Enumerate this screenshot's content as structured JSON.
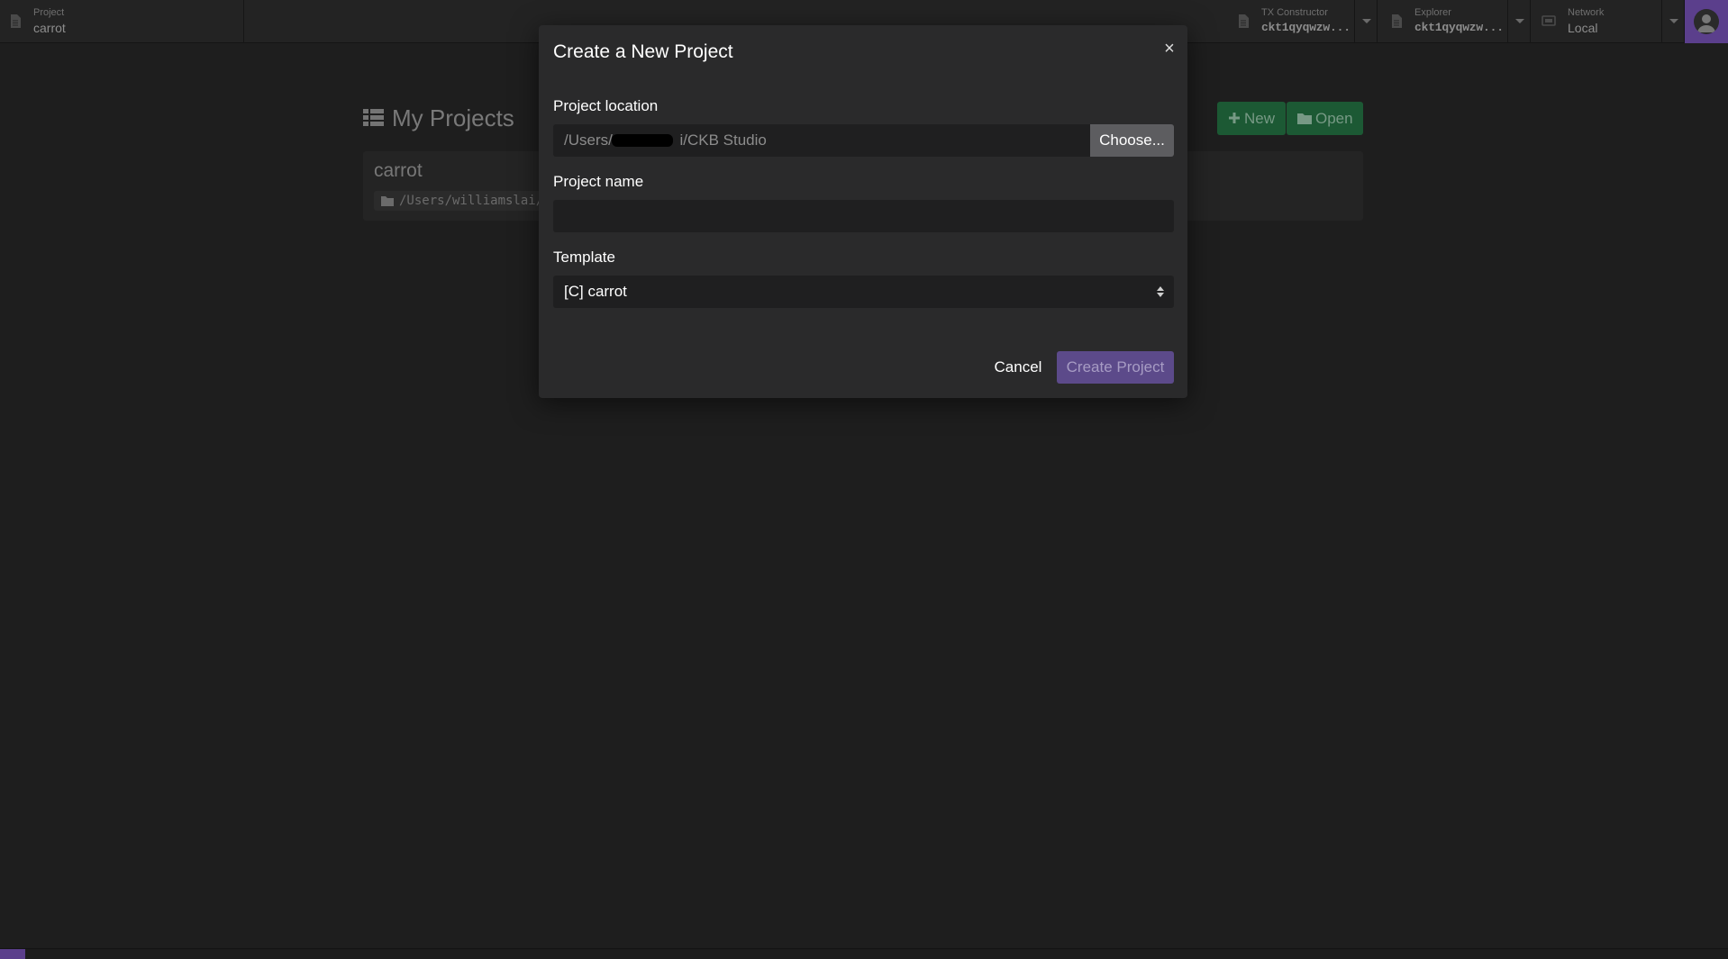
{
  "topbar": {
    "project": {
      "label": "Project",
      "value": "carrot",
      "icon": "file-icon"
    },
    "tx_constructor": {
      "label": "TX Constructor",
      "value": "ckt1qyqwzw...",
      "icon": "file-icon"
    },
    "explorer": {
      "label": "Explorer",
      "value": "ckt1qyqwzw...",
      "icon": "file-icon"
    },
    "network": {
      "label": "Network",
      "value": "Local",
      "icon": "server-icon"
    },
    "avatar_icon": "user-icon"
  },
  "background": {
    "title": "My Projects",
    "new_label": "New",
    "open_label": "Open",
    "projects": [
      {
        "name": "carrot",
        "path": "/Users/williamslai/"
      }
    ]
  },
  "modal": {
    "title": "Create a New Project",
    "close_symbol": "×",
    "location_label": "Project location",
    "location_value": "/Users/v              i/CKB Studio",
    "choose_label": "Choose...",
    "name_label": "Project name",
    "name_value": "",
    "template_label": "Template",
    "template_value": "[C] carrot",
    "cancel_label": "Cancel",
    "create_label": "Create Project"
  },
  "colors": {
    "accent_purple": "#5b3f8c",
    "create_button": "#5c4a8a",
    "green_button": "#1d5b36"
  }
}
